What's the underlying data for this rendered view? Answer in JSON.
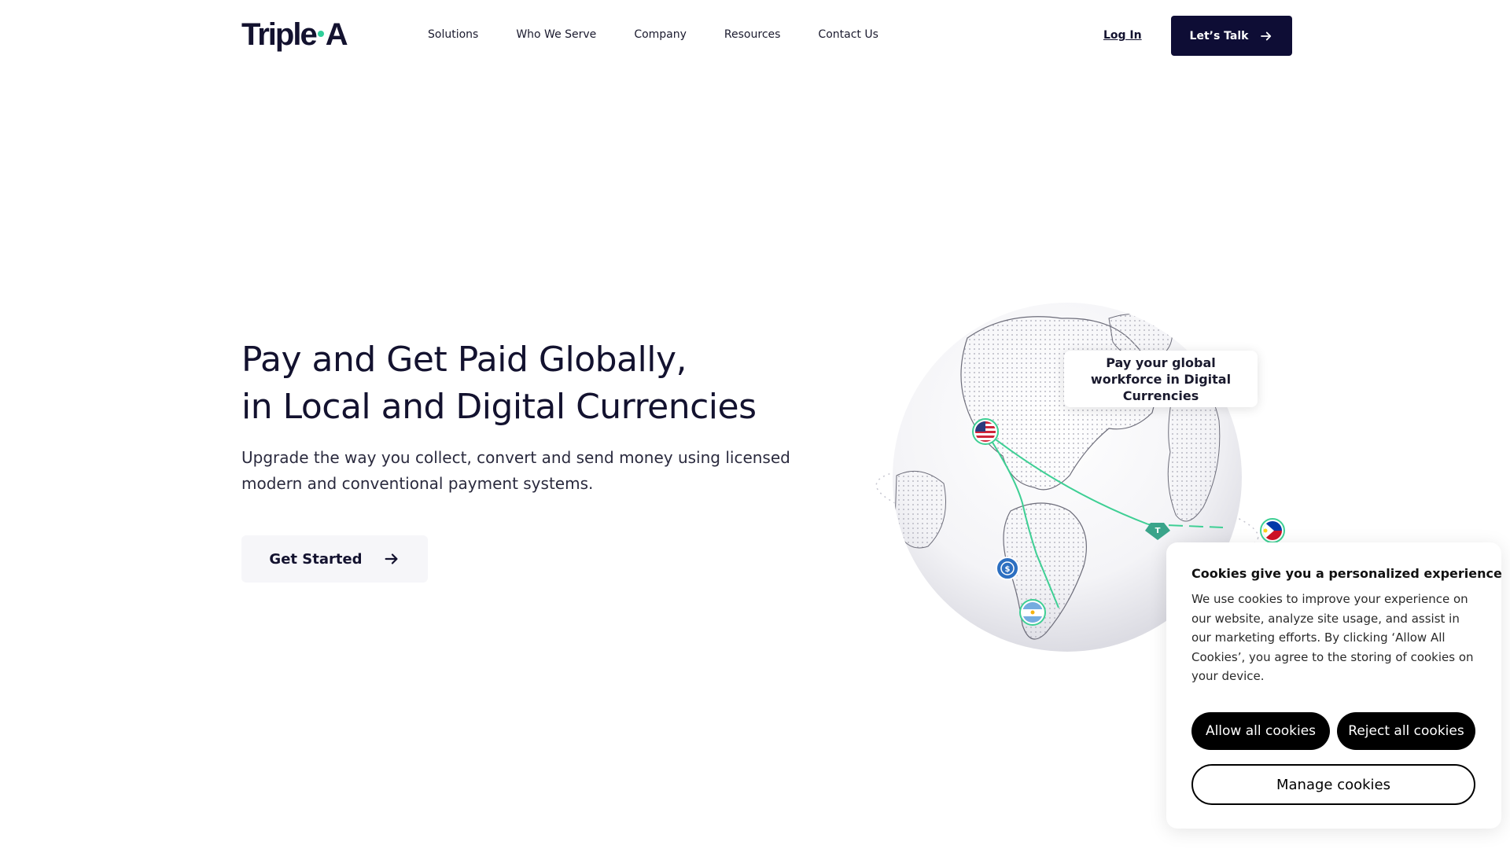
{
  "header": {
    "logo_left": "Triple",
    "logo_right": "A",
    "nav": [
      "Solutions",
      "Who We Serve",
      "Company",
      "Resources",
      "Contact Us"
    ],
    "login_label": "Log In",
    "cta_label": "Let’s Talk"
  },
  "hero": {
    "title_line1": "Pay and Get Paid Globally,",
    "title_line2": "in Local and Digital Currencies",
    "subtitle": "Upgrade the way you collect, convert and send money using licensed modern and conventional payment systems.",
    "button_label": "Get Started"
  },
  "globe": {
    "tooltip": "Pay your global workforce in Digital Currencies",
    "accent_color": "#3ecf94",
    "flags": [
      "us-flag",
      "argentina-flag",
      "philippines-flag"
    ],
    "coin_icons": [
      "usdc-coin-icon",
      "tether-coin-icon"
    ]
  },
  "cookie": {
    "title": "Cookies give you a personalized experience",
    "body": "We use cookies to improve your experience on our website, analyze site usage, and assist in our marketing efforts. By clicking ‘Allow All Cookies’, you agree to the storing of cookies on your device.",
    "allow_label": "Allow all cookies",
    "reject_label": "Reject all cookies",
    "manage_label": "Manage cookies"
  },
  "colors": {
    "brand_navy": "#0e0d35",
    "brand_green": "#2fcf9a",
    "button_black": "#000000"
  }
}
